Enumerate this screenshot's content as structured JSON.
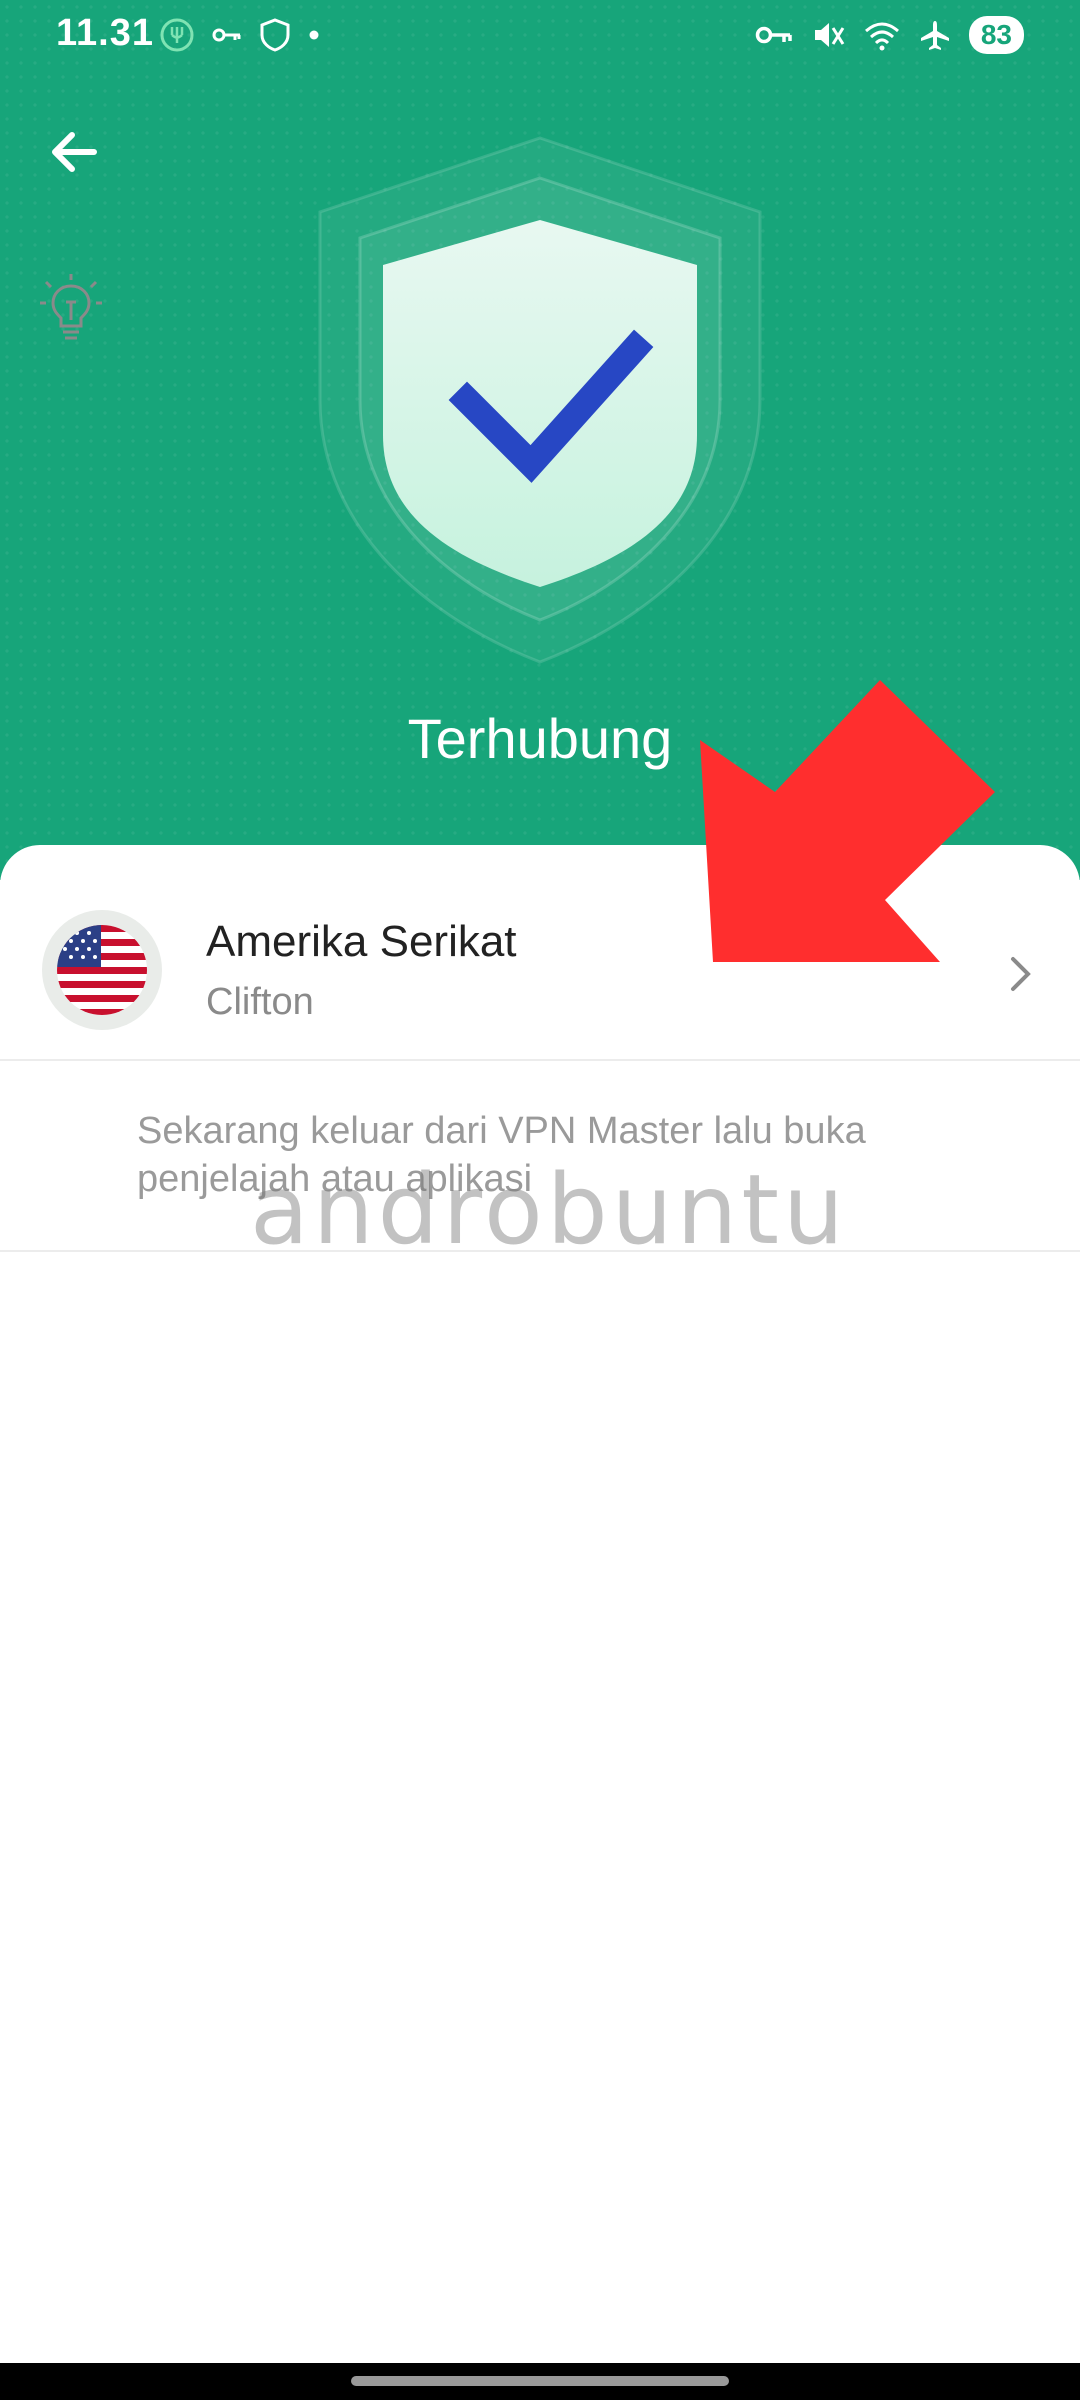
{
  "status_bar": {
    "time": "11.31",
    "battery": "83",
    "left_icons": [
      "fork-icon",
      "key-icon",
      "shield-icon",
      "dot-icon"
    ],
    "right_icons": [
      "vpn-key-icon",
      "mute-icon",
      "wifi-icon",
      "airplane-icon"
    ]
  },
  "header": {
    "status_title": "Terhubung",
    "accent_color": "#17a57a",
    "check_color": "#2747c4"
  },
  "server": {
    "country": "Amerika Serikat",
    "city": "Clifton",
    "flag": "us-flag-icon"
  },
  "tip": {
    "text": "Sekarang keluar dari VPN Master lalu buka penjelajah atau aplikasi"
  },
  "watermark": "androbuntu",
  "annotation": {
    "arrow_color": "#ff2e2e"
  }
}
